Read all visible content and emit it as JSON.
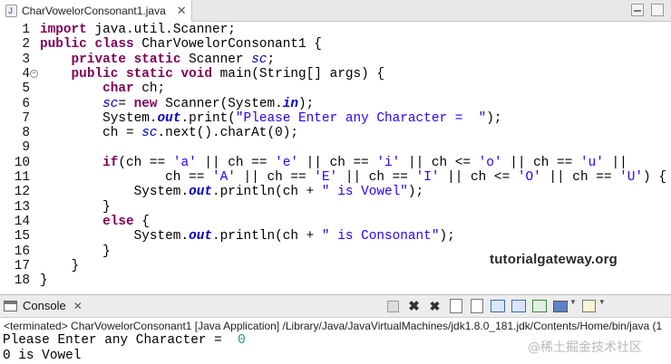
{
  "editor_tab": {
    "label": "CharVowelorConsonant1.java",
    "close": "✕"
  },
  "code_lines": [
    {
      "n": "1",
      "segs": [
        {
          "t": "import",
          "c": "kw"
        },
        {
          "t": " java.util.Scanner;",
          "c": ""
        }
      ]
    },
    {
      "n": "2",
      "segs": [
        {
          "t": "public",
          "c": "kw"
        },
        {
          "t": " ",
          "c": ""
        },
        {
          "t": "class",
          "c": "kw"
        },
        {
          "t": " CharVowelorConsonant1 {",
          "c": ""
        }
      ]
    },
    {
      "n": "3",
      "segs": [
        {
          "t": "    ",
          "c": ""
        },
        {
          "t": "private",
          "c": "kw"
        },
        {
          "t": " ",
          "c": ""
        },
        {
          "t": "static",
          "c": "kw"
        },
        {
          "t": " Scanner ",
          "c": ""
        },
        {
          "t": "sc",
          "c": "fld"
        },
        {
          "t": ";",
          "c": ""
        }
      ]
    },
    {
      "n": "4",
      "fold": true,
      "segs": [
        {
          "t": "    ",
          "c": ""
        },
        {
          "t": "public",
          "c": "kw"
        },
        {
          "t": " ",
          "c": ""
        },
        {
          "t": "static",
          "c": "kw"
        },
        {
          "t": " ",
          "c": ""
        },
        {
          "t": "void",
          "c": "kw"
        },
        {
          "t": " main(String[] args) {",
          "c": ""
        }
      ]
    },
    {
      "n": "5",
      "segs": [
        {
          "t": "        ",
          "c": ""
        },
        {
          "t": "char",
          "c": "kw"
        },
        {
          "t": " ch;",
          "c": ""
        }
      ]
    },
    {
      "n": "6",
      "segs": [
        {
          "t": "        ",
          "c": ""
        },
        {
          "t": "sc",
          "c": "fld"
        },
        {
          "t": "= ",
          "c": ""
        },
        {
          "t": "new",
          "c": "kw"
        },
        {
          "t": " Scanner(System.",
          "c": ""
        },
        {
          "t": "in",
          "c": "sfld"
        },
        {
          "t": ");",
          "c": ""
        }
      ]
    },
    {
      "n": "7",
      "segs": [
        {
          "t": "        System.",
          "c": ""
        },
        {
          "t": "out",
          "c": "sfld"
        },
        {
          "t": ".print(",
          "c": ""
        },
        {
          "t": "\"Please Enter any Character =  \"",
          "c": "str"
        },
        {
          "t": ");",
          "c": ""
        }
      ]
    },
    {
      "n": "8",
      "segs": [
        {
          "t": "        ch = ",
          "c": ""
        },
        {
          "t": "sc",
          "c": "fld"
        },
        {
          "t": ".next().charAt(0);",
          "c": ""
        }
      ]
    },
    {
      "n": "9",
      "segs": []
    },
    {
      "n": "10",
      "segs": [
        {
          "t": "        ",
          "c": ""
        },
        {
          "t": "if",
          "c": "kw"
        },
        {
          "t": "(ch == ",
          "c": ""
        },
        {
          "t": "'a'",
          "c": "str"
        },
        {
          "t": " || ch == ",
          "c": ""
        },
        {
          "t": "'e'",
          "c": "str"
        },
        {
          "t": " || ch == ",
          "c": ""
        },
        {
          "t": "'i'",
          "c": "str"
        },
        {
          "t": " || ch <= ",
          "c": ""
        },
        {
          "t": "'o'",
          "c": "str"
        },
        {
          "t": " || ch == ",
          "c": ""
        },
        {
          "t": "'u'",
          "c": "str"
        },
        {
          "t": " ||",
          "c": ""
        }
      ]
    },
    {
      "n": "11",
      "segs": [
        {
          "t": "                ch == ",
          "c": ""
        },
        {
          "t": "'A'",
          "c": "str"
        },
        {
          "t": " || ch == ",
          "c": ""
        },
        {
          "t": "'E'",
          "c": "str"
        },
        {
          "t": " || ch == ",
          "c": ""
        },
        {
          "t": "'I'",
          "c": "str"
        },
        {
          "t": " || ch <= ",
          "c": ""
        },
        {
          "t": "'O'",
          "c": "str"
        },
        {
          "t": " || ch == ",
          "c": ""
        },
        {
          "t": "'U'",
          "c": "str"
        },
        {
          "t": ") {",
          "c": ""
        }
      ]
    },
    {
      "n": "12",
      "segs": [
        {
          "t": "            System.",
          "c": ""
        },
        {
          "t": "out",
          "c": "sfld"
        },
        {
          "t": ".println(ch + ",
          "c": ""
        },
        {
          "t": "\" is Vowel\"",
          "c": "str"
        },
        {
          "t": ");",
          "c": ""
        }
      ]
    },
    {
      "n": "13",
      "segs": [
        {
          "t": "        }",
          "c": ""
        }
      ]
    },
    {
      "n": "14",
      "segs": [
        {
          "t": "        ",
          "c": ""
        },
        {
          "t": "else",
          "c": "kw"
        },
        {
          "t": " {",
          "c": ""
        }
      ]
    },
    {
      "n": "15",
      "segs": [
        {
          "t": "            System.",
          "c": ""
        },
        {
          "t": "out",
          "c": "sfld"
        },
        {
          "t": ".println(ch + ",
          "c": ""
        },
        {
          "t": "\" is Consonant\"",
          "c": "str"
        },
        {
          "t": ");",
          "c": ""
        }
      ]
    },
    {
      "n": "16",
      "segs": [
        {
          "t": "        }",
          "c": ""
        }
      ]
    },
    {
      "n": "17",
      "segs": [
        {
          "t": "    }",
          "c": ""
        }
      ]
    },
    {
      "n": "18",
      "segs": [
        {
          "t": "}",
          "c": ""
        }
      ]
    }
  ],
  "watermark": "tutorialgateway.org",
  "console": {
    "tab_label": "Console",
    "tab_close": "✕",
    "path": "<terminated> CharVowelorConsonant1 [Java Application] /Library/Java/JavaVirtualMachines/jdk1.8.0_181.jdk/Contents/Home/bin/java  (1",
    "prompt": "Please Enter any Character =  ",
    "input": "0",
    "result": "0 is Vowel",
    "watermark_cn": "@稀土掘金技术社区"
  },
  "toolbar_icons": [
    "terminate-icon",
    "remove-launch-icon",
    "remove-all-terminated-icon",
    "scroll-lock-icon",
    "word-wrap-icon",
    "show-on-stdout-icon",
    "show-on-stderr-icon",
    "pin-console-icon",
    "display-console-icon",
    "open-console-icon"
  ]
}
